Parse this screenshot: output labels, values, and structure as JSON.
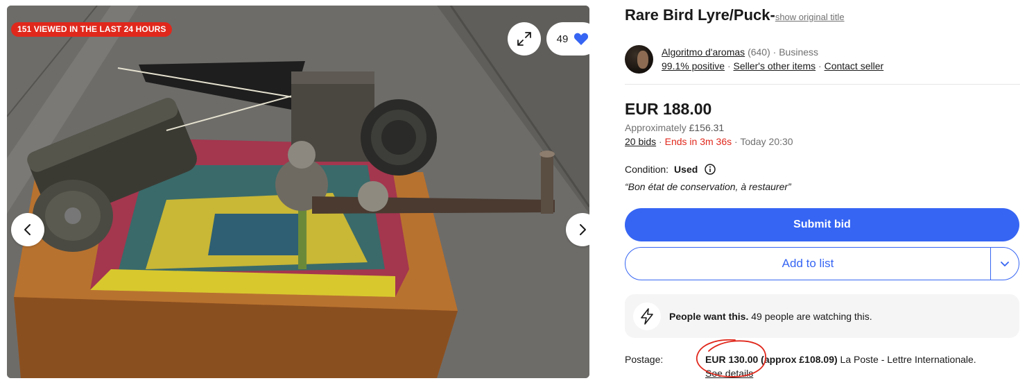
{
  "gallery": {
    "viewed_badge": "151 VIEWED IN THE LAST 24 HOURS",
    "watch_count": "49",
    "icons": {
      "expand": "expand-icon",
      "watch": "heart-icon",
      "prev": "chevron-left-icon",
      "next": "chevron-right-icon"
    }
  },
  "listing": {
    "title": "Rare Bird Lyre/Puck-",
    "show_original": "show original title"
  },
  "seller": {
    "name": "Algoritmo d'aromas",
    "feedback_count": "(640)",
    "separator": "·",
    "type": "Business",
    "positive": "99.1% positive",
    "other_items": "Seller's other items",
    "contact": "Contact seller"
  },
  "price": {
    "amount": "EUR 188.00",
    "approx_label": "Approximately",
    "approx_value": "£156.31",
    "bids": "20 bids",
    "ends_in": "Ends in 3m 36s",
    "end_time": "Today 20:30"
  },
  "condition": {
    "label": "Condition:",
    "value": "Used",
    "note": "“Bon état de conservation, à restaurer”"
  },
  "actions": {
    "submit_bid": "Submit bid",
    "add_to_list": "Add to list"
  },
  "social": {
    "headline": "People want this.",
    "detail": " 49 people are watching this."
  },
  "postage": {
    "label": "Postage:",
    "price": "EUR 130.00",
    "approx": " (approx £108.09)",
    "service": " La Poste - Lettre Internationale.",
    "see_details": "See details"
  },
  "colors": {
    "accent": "#3665f3",
    "badge_red": "#e0281c",
    "annotation_red": "#e0281c"
  }
}
